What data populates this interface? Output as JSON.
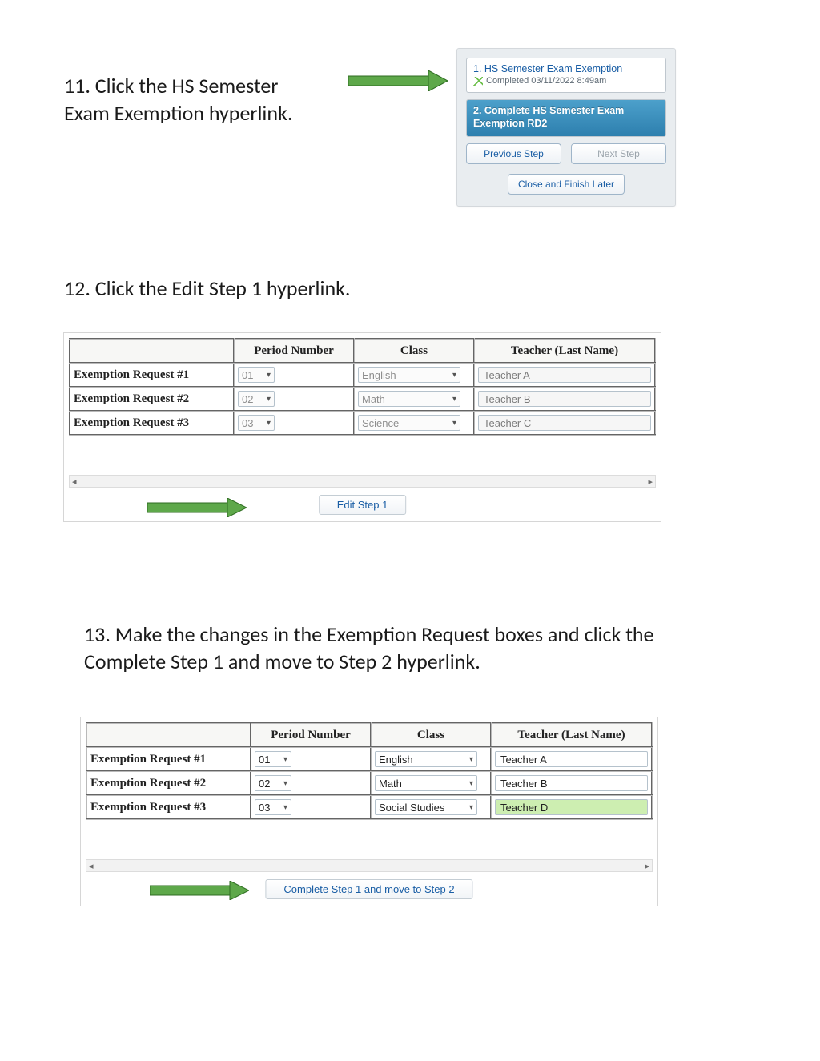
{
  "step11": {
    "text": "11. Click the HS Semester Exam Exemption hyperlink."
  },
  "step12": {
    "text": "12. Click the Edit Step 1 hyperlink."
  },
  "step13": {
    "text": "13. Make the changes in the Exemption Request boxes and click the Complete Step 1 and move to Step 2 hyperlink."
  },
  "navpanel": {
    "step1_title": "1. HS Semester Exam Exemption",
    "step1_sub": "Completed 03/11/2022 8:49am",
    "step2_title": "2. Complete HS Semester Exam Exemption RD2",
    "prev_label": "Previous Step",
    "next_label": "Next Step",
    "close_label": "Close and Finish Later"
  },
  "table_headers": {
    "blank": "",
    "period": "Period Number",
    "class": "Class",
    "teacher": "Teacher (Last Name)"
  },
  "table_a": {
    "rows": [
      {
        "label": "Exemption Request #1",
        "period": "01",
        "class": "English",
        "teacher": "Teacher A"
      },
      {
        "label": "Exemption Request #2",
        "period": "02",
        "class": "Math",
        "teacher": "Teacher B"
      },
      {
        "label": "Exemption Request #3",
        "period": "03",
        "class": "Science",
        "teacher": "Teacher C"
      }
    ],
    "action": "Edit Step 1"
  },
  "table_b": {
    "rows": [
      {
        "label": "Exemption Request #1",
        "period": "01",
        "class": "English",
        "teacher": "Teacher A",
        "hl": false
      },
      {
        "label": "Exemption Request #2",
        "period": "02",
        "class": "Math",
        "teacher": "Teacher B",
        "hl": false
      },
      {
        "label": "Exemption Request #3",
        "period": "03",
        "class": "Social Studies",
        "teacher": "Teacher D",
        "hl": true
      }
    ],
    "action": "Complete Step 1 and move to Step 2"
  },
  "glyphs": {
    "caret": "▾",
    "tri_l": "◂",
    "tri_r": "▸"
  }
}
